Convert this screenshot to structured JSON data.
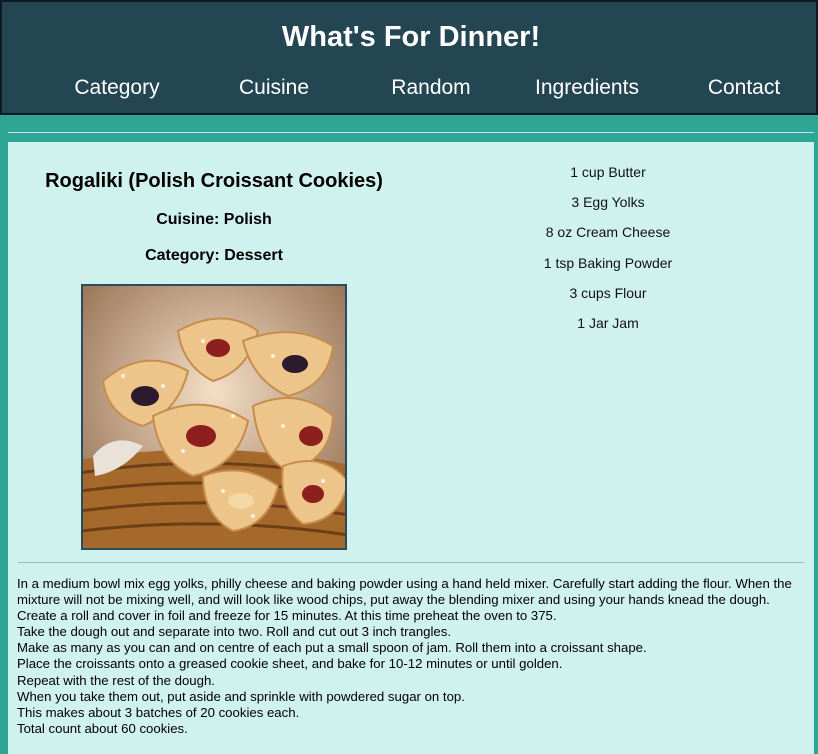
{
  "header": {
    "title": "What's For Dinner!",
    "nav": [
      "Category",
      "Cuisine",
      "Random",
      "Ingredients",
      "Contact"
    ]
  },
  "recipe": {
    "title": "Rogaliki (Polish Croissant Cookies)",
    "cuisine": "Cuisine: Polish",
    "category": "Category: Dessert",
    "image_icon": "cookie-photo",
    "ingredients": [
      "1 cup Butter",
      "3 Egg Yolks",
      "8 oz Cream Cheese",
      "1 tsp Baking Powder",
      "3 cups Flour",
      "1 Jar Jam"
    ],
    "instructions": [
      "In a medium bowl mix egg yolks, philly cheese and baking powder using a hand held mixer. Carefully start adding the flour. When the mixture will not be mixing well, and will look like wood chips, put away the blending mixer and using your hands knead the dough.",
      "Create a roll and cover in foil and freeze for 15 minutes. At this time preheat the oven to 375.",
      "Take the dough out and separate into two. Roll and cut out 3 inch trangles.",
      "Make as many as you can and on centre of each put a small spoon of jam. Roll them into a croissant shape.",
      "Place the croissants onto a greased cookie sheet, and bake for 10-12 minutes or until golden.",
      "Repeat with the rest of the dough.",
      "When you take them out, put aside and sprinkle with powdered sugar on top.",
      "This makes about 3 batches of 20 cookies each.",
      "Total count about 60 cookies."
    ]
  },
  "colors": {
    "header_bg": "#244653",
    "page_bg": "#2fa595",
    "content_bg": "#d0f2ee"
  }
}
